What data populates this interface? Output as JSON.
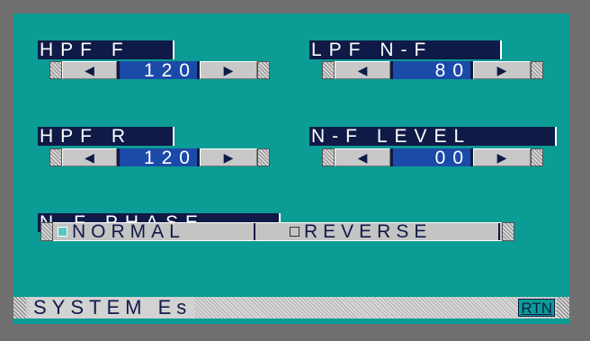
{
  "hpf_f": {
    "label": "HPF F",
    "value": "120"
  },
  "lpf_nf": {
    "label": "LPF N-F",
    "value": "80"
  },
  "hpf_r": {
    "label": "HPF R",
    "value": "120"
  },
  "nf_level": {
    "label": "N-F LEVEL",
    "value": "00"
  },
  "nf_phase": {
    "label": "N-F PHASE",
    "options": [
      "NORMAL",
      "REVERSE"
    ],
    "selected": "NORMAL"
  },
  "bottom_bar": {
    "title": "SYSTEM Es",
    "return_label": "RTN"
  },
  "arrows": {
    "left": "◀",
    "right": "▶"
  },
  "colors": {
    "screen": "#0b9c95",
    "label_bg": "#0f1a47",
    "value_bg": "#1c4aa9",
    "control": "#c8c8c8"
  }
}
